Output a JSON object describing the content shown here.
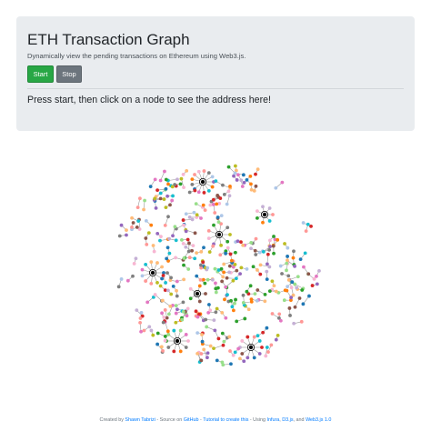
{
  "header": {
    "title": "ETH Transaction Graph",
    "subtitle": "Dynamically view the pending transactions on Ethereum using Web3.js.",
    "start_label": "Start",
    "stop_label": "Stop",
    "prompt": "Press start, then click on a node to see the address here!"
  },
  "footer": {
    "created_by": "Created by",
    "author": "Shawn Tabrizi",
    "source_text": "- Source on",
    "github": "GitHub",
    "dash": "-",
    "tutorial": "Tutorial to create this",
    "using_text": "- Using",
    "infura": "Infura",
    "comma": ",",
    "d3": "D3.js",
    "and_text": ", and",
    "web3": "Web3.js 1.0"
  },
  "colors": {
    "palette": [
      "#1f77b4",
      "#ff7f0e",
      "#2ca02c",
      "#d62728",
      "#9467bd",
      "#8c564b",
      "#e377c2",
      "#7f7f7f",
      "#bcbd22",
      "#17becf",
      "#aec7e8",
      "#ffbb78",
      "#98df8a",
      "#ff9896",
      "#c5b0d5",
      "#f7b6d2"
    ],
    "link": "#999999",
    "center_node": "#000000",
    "accent": "#007bff"
  }
}
